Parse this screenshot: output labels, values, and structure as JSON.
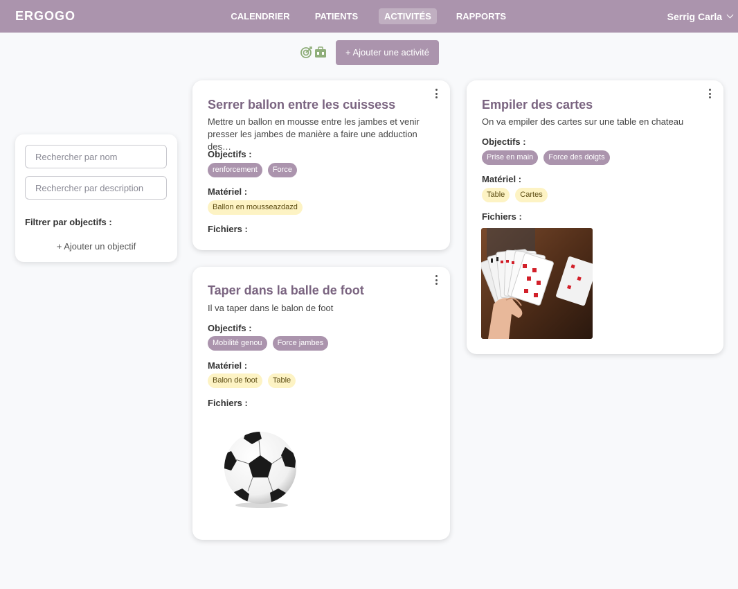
{
  "app": {
    "brand": "ERGOGO"
  },
  "nav": {
    "items": [
      {
        "label": "CALENDRIER",
        "active": false
      },
      {
        "label": "PATIENTS",
        "active": false
      },
      {
        "label": "ACTIVITÉS",
        "active": true
      },
      {
        "label": "RAPPORTS",
        "active": false
      }
    ],
    "user": "Serrig Carla"
  },
  "toolbar": {
    "icons": [
      "target-icon",
      "toolbox-icon"
    ],
    "add_button": "+ Ajouter une activité"
  },
  "sidebar": {
    "search_name_placeholder": "Rechercher par nom",
    "search_desc_placeholder": "Rechercher par description",
    "filter_label": "Filtrer par objectifs :",
    "add_objective": "+ Ajouter un objectif"
  },
  "labels": {
    "objectifs": "Objectifs :",
    "materiel": "Matériel :",
    "fichiers": "Fichiers :"
  },
  "activities": [
    {
      "title": "Serrer ballon entre les cuissess",
      "description": "Mettre un ballon en mousse entre les jambes et venir presser les jambes de manière a faire une adduction des…",
      "objectifs": [
        "renforcement",
        "Force"
      ],
      "materiel": [
        "Ballon en mousseazdazd"
      ],
      "fichiers": []
    },
    {
      "title": "Taper dans la balle de foot",
      "description": "Il va taper dans le balon de foot",
      "objectifs": [
        "Mobilité genou",
        "Force jambes"
      ],
      "materiel": [
        "Balon de foot",
        "Table"
      ],
      "fichiers": [
        "soccer-ball-image"
      ]
    },
    {
      "title": "Empiler des cartes",
      "description": "On va empiler des cartes sur une table en chateau",
      "objectifs": [
        "Prise en main",
        "Force des doigts"
      ],
      "materiel": [
        "Table",
        "Cartes"
      ],
      "fichiers": [
        "playing-cards-image"
      ]
    }
  ],
  "colors": {
    "accent": "#ab94ad",
    "title": "#7a6480",
    "material_tag": "#fdf3c4",
    "background": "#f8f9fb"
  }
}
